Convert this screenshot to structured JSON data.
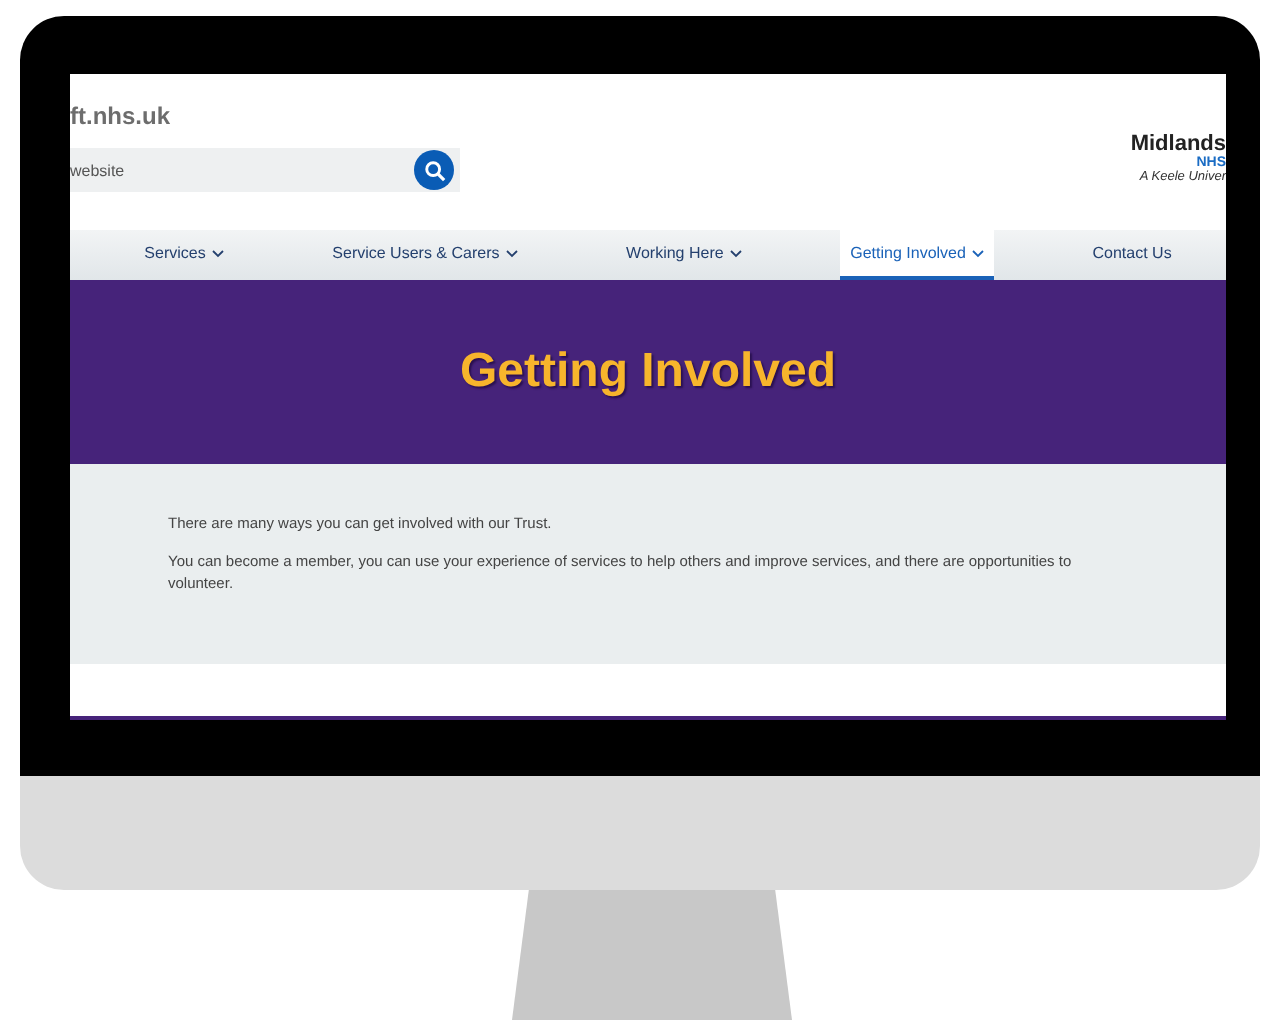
{
  "header": {
    "site_address": "ft.nhs.uk",
    "search": {
      "placeholder": "website"
    },
    "logo": {
      "name": "Midlands",
      "subtitle": "NHS",
      "tagline": "A Keele Univer"
    }
  },
  "nav": [
    {
      "label": "Services",
      "selected": false
    },
    {
      "label": "Service Users & Carers",
      "selected": false
    },
    {
      "label": "Working Here",
      "selected": false
    },
    {
      "label": "Getting Involved",
      "selected": true
    },
    {
      "label": "Contact Us",
      "selected": false,
      "kind": "plain"
    }
  ],
  "hero": {
    "title": "Getting Involved"
  },
  "content": {
    "paragraphs": [
      "There are many ways you can get involved with our Trust.",
      "You can become a member, you can use your experience of services to help others and improve services, and there are opportunities to volunteer."
    ]
  }
}
